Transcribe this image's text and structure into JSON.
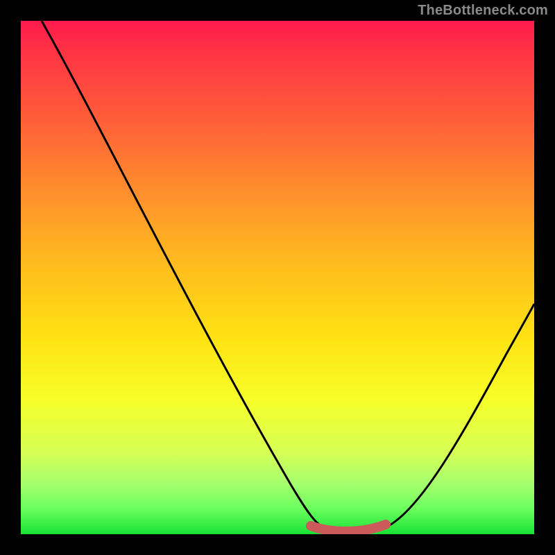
{
  "watermark": "TheBottleneck.com",
  "colors": {
    "page_bg": "#000000",
    "curve": "#000000",
    "flat_segment": "#cc5a5a",
    "watermark_text": "#8a8a8a"
  },
  "chart_data": {
    "type": "line",
    "title": "",
    "xlabel": "",
    "ylabel": "",
    "xlim": [
      0,
      100
    ],
    "ylim": [
      0,
      100
    ],
    "grid": false,
    "legend": false,
    "series": [
      {
        "name": "curve",
        "x": [
          0,
          12,
          24,
          36,
          48,
          58,
          62,
          68,
          72,
          80,
          88,
          100
        ],
        "y": [
          100,
          80,
          60,
          40,
          20,
          4,
          1,
          1,
          4,
          18,
          40,
          68
        ]
      }
    ],
    "flat_region": {
      "x_start": 58,
      "x_end": 72,
      "y": 1
    }
  }
}
